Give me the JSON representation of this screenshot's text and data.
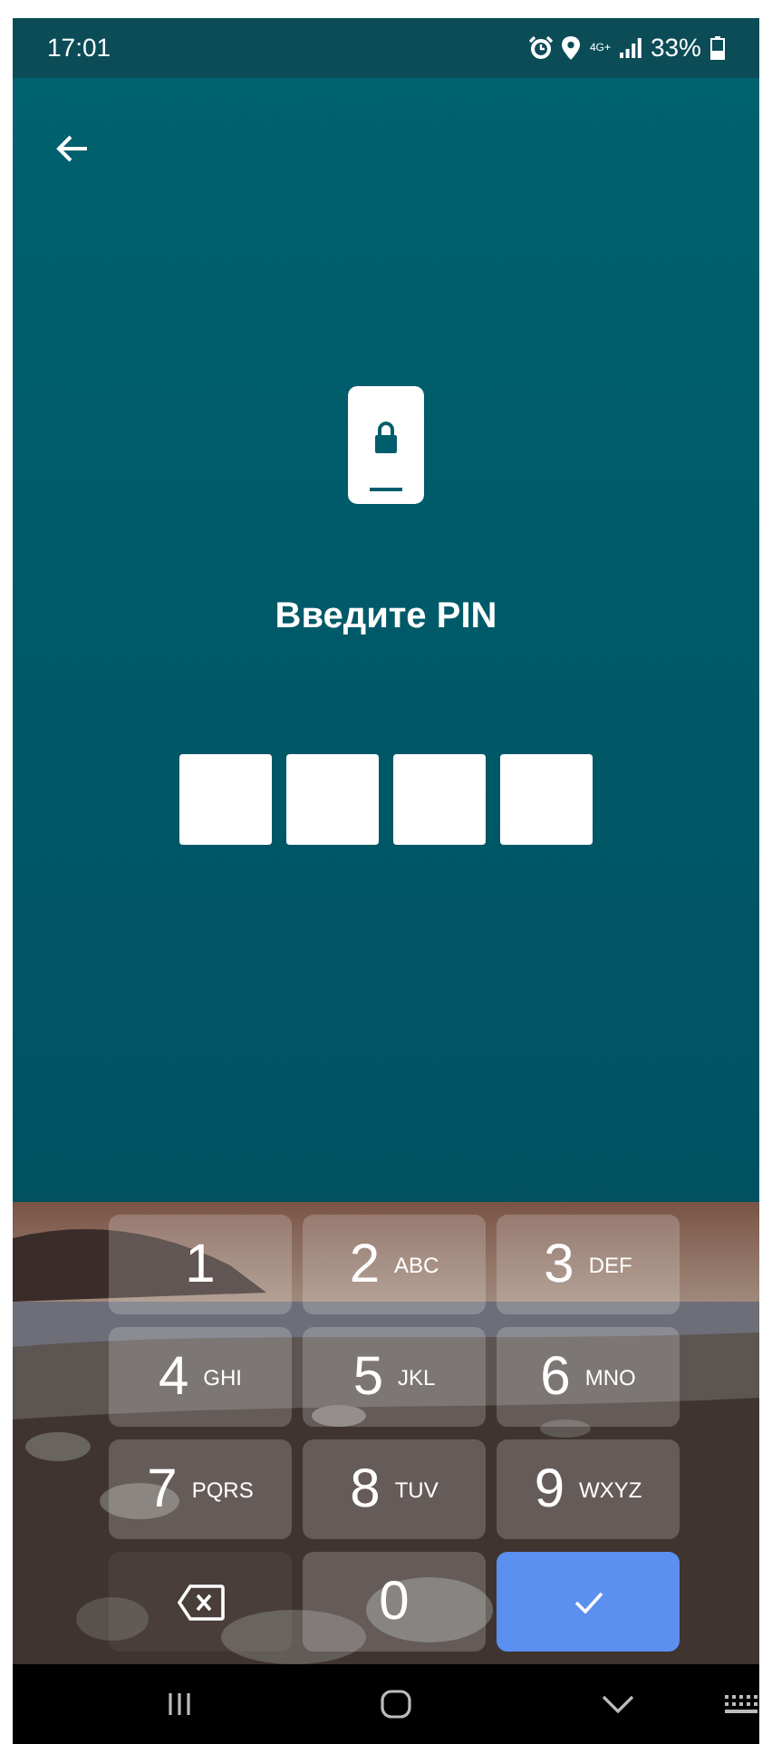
{
  "status_bar": {
    "time": "17:01",
    "network": "4G+",
    "battery": "33%"
  },
  "title": "Введите PIN",
  "pin_boxes": [
    {
      "filled": false
    },
    {
      "filled": false
    },
    {
      "filled": false
    },
    {
      "filled": false
    }
  ],
  "keypad": [
    {
      "kind": "digit",
      "digit": "1"
    },
    {
      "kind": "digit",
      "digit": "2",
      "letters": "ABC"
    },
    {
      "kind": "digit",
      "digit": "3",
      "letters": "DEF"
    },
    {
      "kind": "digit",
      "digit": "4",
      "letters": "GHI"
    },
    {
      "kind": "digit",
      "digit": "5",
      "letters": "JKL"
    },
    {
      "kind": "digit",
      "digit": "6",
      "letters": "MNO"
    },
    {
      "kind": "digit",
      "digit": "7",
      "letters": "PQRS"
    },
    {
      "kind": "digit",
      "digit": "8",
      "letters": "TUV"
    },
    {
      "kind": "digit",
      "digit": "9",
      "letters": "WXYZ"
    },
    {
      "kind": "backspace"
    },
    {
      "kind": "digit",
      "digit": "0"
    },
    {
      "kind": "confirm"
    }
  ]
}
